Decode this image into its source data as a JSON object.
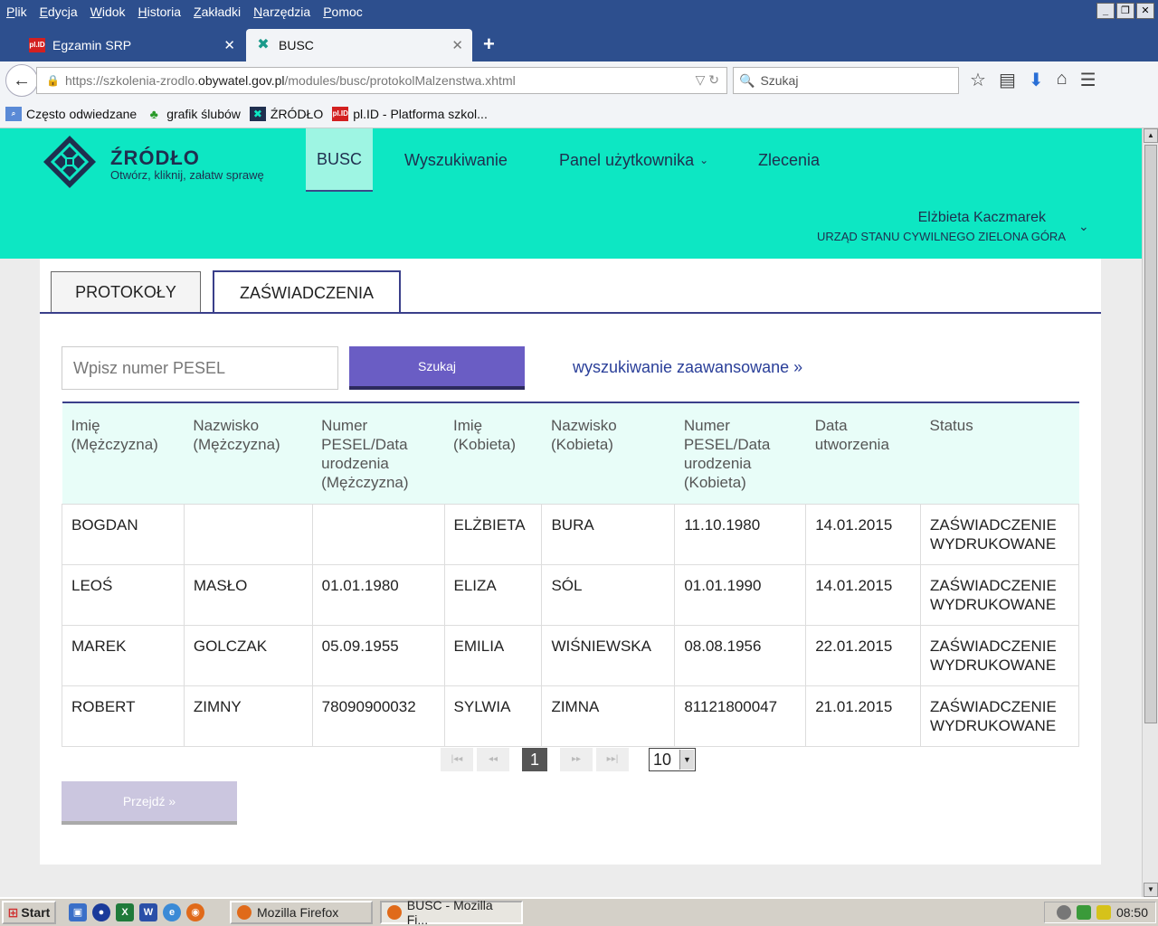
{
  "browser": {
    "menu": [
      "Plik",
      "Edycja",
      "Widok",
      "Historia",
      "Zakładki",
      "Narzędzia",
      "Pomoc"
    ],
    "tabs": [
      {
        "title": "Egzamin SRP",
        "icon": "plid-icon"
      },
      {
        "title": "BUSC",
        "icon": "busc-icon"
      }
    ],
    "new_tab": "+",
    "url_prefix": "https://szkolenia-zrodlo.",
    "url_domain": "obywatel.gov.pl",
    "url_suffix": "/modules/busc/protokolMalzenstwa.xhtml",
    "search_placeholder": "Szukaj",
    "bookmarks": [
      {
        "label": "Często odwiedzane",
        "icon": "frequent-icon"
      },
      {
        "label": "grafik ślubów",
        "icon": "tree-icon"
      },
      {
        "label": "ŹRÓDŁO",
        "icon": "zrodlo-icon"
      },
      {
        "label": "pl.ID - Platforma szkol...",
        "icon": "plid-icon"
      }
    ],
    "plid_badge": "pl.ID"
  },
  "site": {
    "logo_title": "ŹRÓDŁO",
    "logo_tagline": "Otwórz, kliknij, załatw sprawę",
    "nav": {
      "busc": "BUSC",
      "search": "Wyszukiwanie",
      "panel": "Panel użytkownika",
      "orders": "Zlecenia"
    },
    "user": {
      "name": "Elżbieta Kaczmarek",
      "office": "URZĄD STANU CYWILNEGO ZIELONA GÓRA"
    },
    "accent": "#0de7c3",
    "button_color": "#6a5dc4"
  },
  "main": {
    "tabs": [
      "PROTOKOŁY",
      "ZAŚWIADCZENIA"
    ],
    "active_tab": "ZAŚWIADCZENIA",
    "search": {
      "placeholder": "Wpisz numer PESEL",
      "button": "Szukaj",
      "advanced_link": "wyszukiwanie zaawansowane »"
    },
    "table": {
      "headers": [
        "Imię (Mężczyzna)",
        "Nazwisko (Mężczyzna)",
        "Numer PESEL/Data urodzenia (Mężczyzna)",
        "Imię (Kobieta)",
        "Nazwisko (Kobieta)",
        "Numer PESEL/Data urodzenia (Kobieta)",
        "Data utworzenia",
        "Status"
      ],
      "rows": [
        [
          "BOGDAN",
          "",
          "",
          "ELŻBIETA",
          "BURA",
          "11.10.1980",
          "14.01.2015",
          "ZAŚWIADCZENIE WYDRUKOWANE"
        ],
        [
          "LEOŚ",
          "MASŁO",
          "01.01.1980",
          "ELIZA",
          "SÓL",
          "01.01.1990",
          "14.01.2015",
          "ZAŚWIADCZENIE WYDRUKOWANE"
        ],
        [
          "MAREK",
          "GOLCZAK",
          "05.09.1955",
          "EMILIA",
          "WIŚNIEWSKA",
          "08.08.1956",
          "22.01.2015",
          "ZAŚWIADCZENIE WYDRUKOWANE"
        ],
        [
          "ROBERT",
          "ZIMNY",
          "78090900032",
          "SYLWIA",
          "ZIMNA",
          "81121800047",
          "21.01.2015",
          "ZAŚWIADCZENIE WYDRUKOWANE"
        ]
      ]
    },
    "pager": {
      "current_page": "1",
      "page_size": "10"
    },
    "goto_button": "Przejdź »"
  },
  "taskbar": {
    "start": "Start",
    "tasks": [
      "Mozilla Firefox",
      "BUSC - Mozilla Fi..."
    ],
    "clock": "08:50"
  }
}
